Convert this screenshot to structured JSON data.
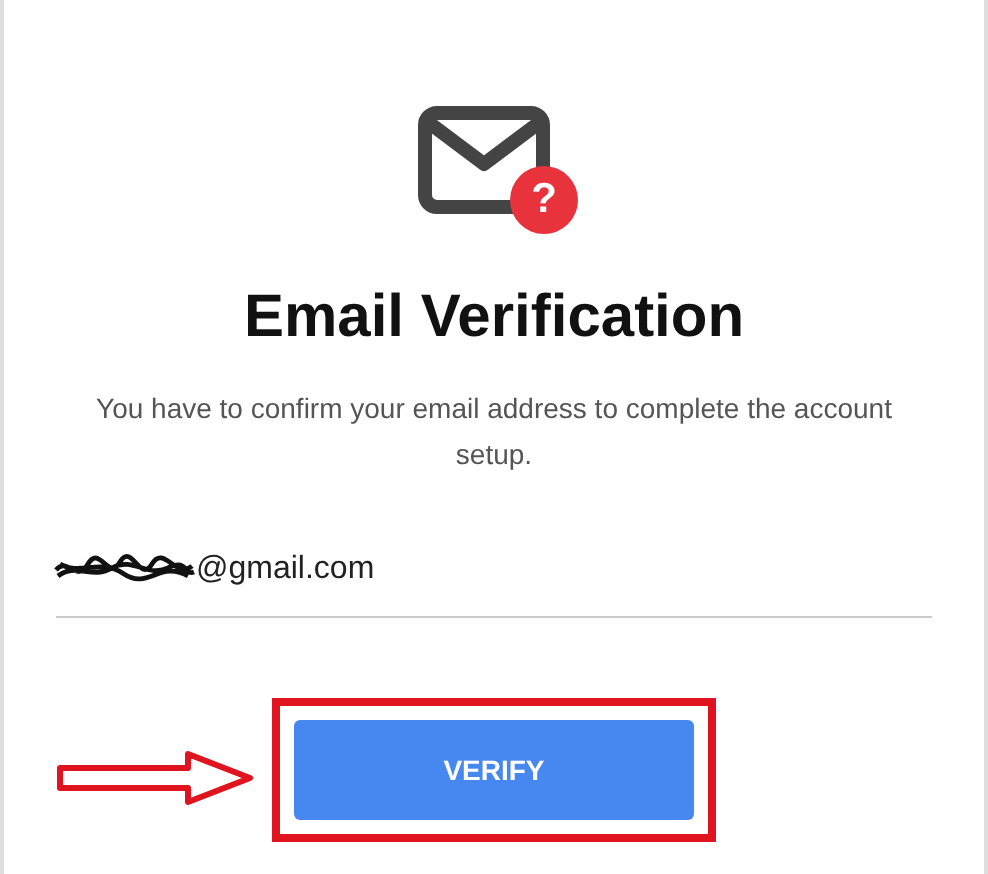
{
  "header": {
    "badge": "?",
    "title": "Email Verification",
    "message": "You have to confirm your email address to complete the account setup."
  },
  "email_field": {
    "value": "@gmail.com",
    "redacted": true
  },
  "button": {
    "label": "VERIFY",
    "highlighted": true
  }
}
